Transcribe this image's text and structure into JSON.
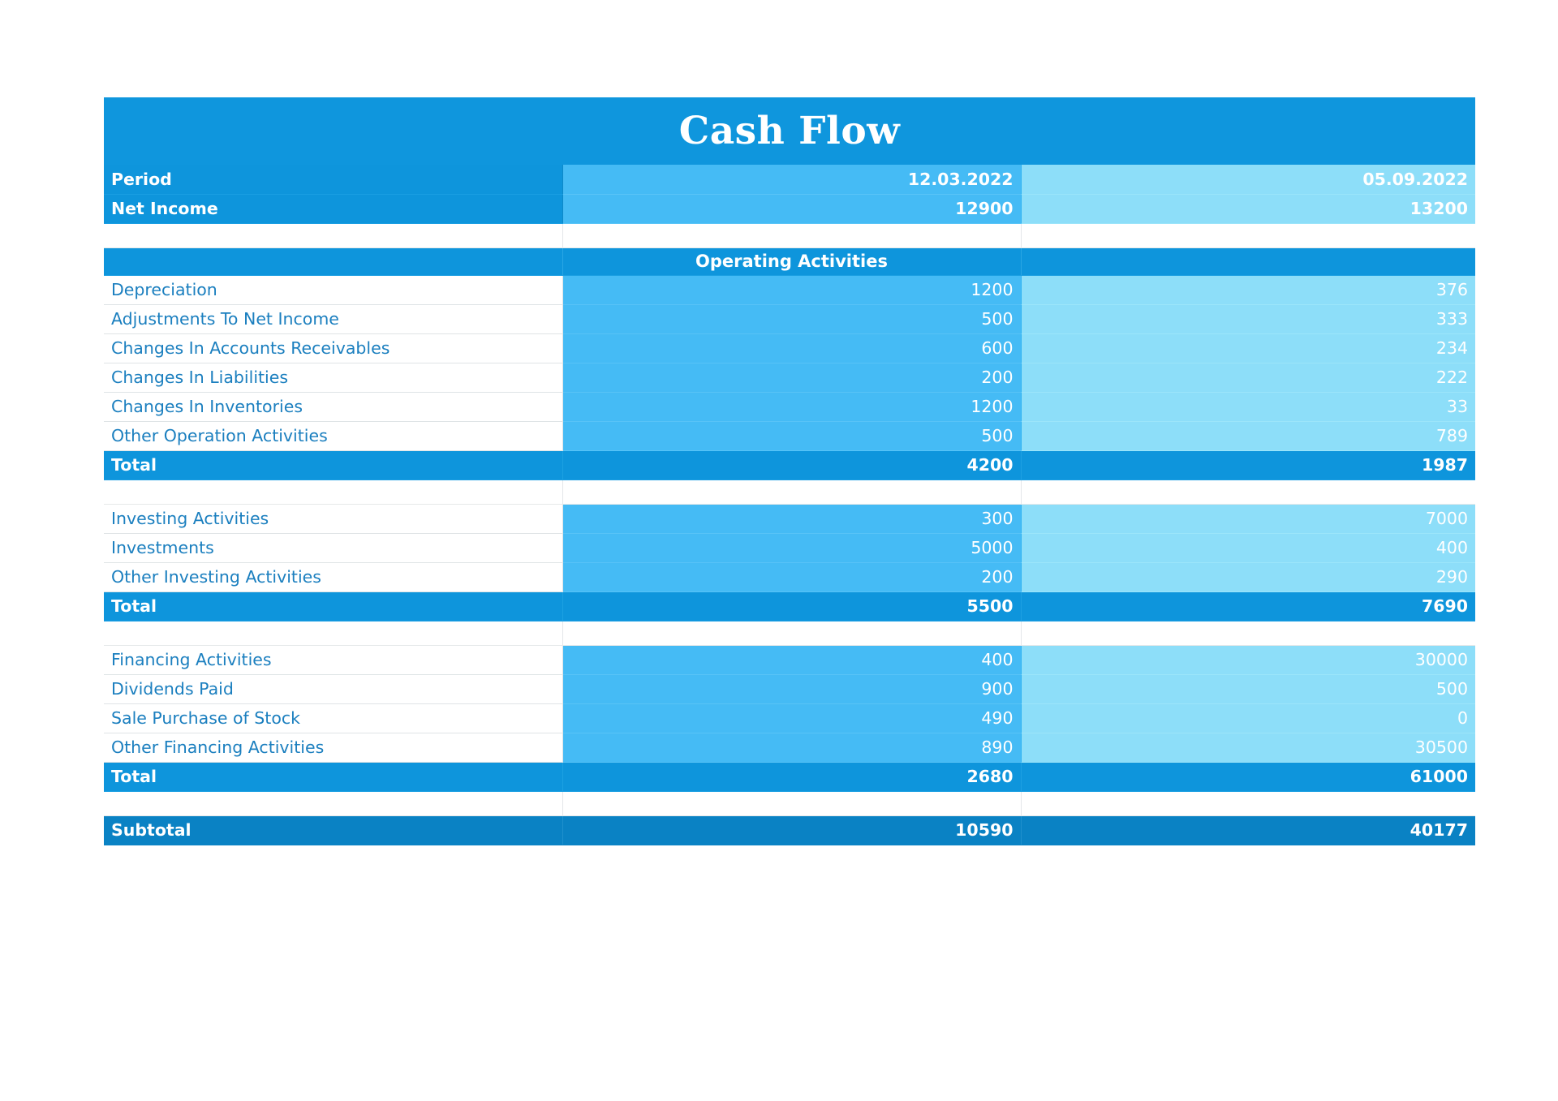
{
  "document": {
    "title": "Cash Flow"
  },
  "colors": {
    "header_blue": "#0e95dc",
    "column_one_blue": "#45bbf5",
    "column_two_cyan": "#8ddef9",
    "subtotal_blue": "#0a82c4",
    "label_text_blue": "#1b7fbf",
    "white": "#ffffff"
  },
  "summary": {
    "period": {
      "label": "Period",
      "value_1": "12.03.2022",
      "value_2": "05.09.2022"
    },
    "net_income": {
      "label": "Net Income",
      "value_1": "12900",
      "value_2": "13200"
    }
  },
  "sections": [
    {
      "banner": "Operating Activities",
      "rows": [
        {
          "label": "Depreciation",
          "value_1": "1200",
          "value_2": "376"
        },
        {
          "label": "Adjustments To Net Income",
          "value_1": "500",
          "value_2": "333"
        },
        {
          "label": "Changes In Accounts Receivables",
          "value_1": "600",
          "value_2": "234"
        },
        {
          "label": "Changes In Liabilities",
          "value_1": "200",
          "value_2": "222"
        },
        {
          "label": "Changes In Inventories",
          "value_1": "1200",
          "value_2": "33"
        },
        {
          "label": "Other Operation Activities",
          "value_1": "500",
          "value_2": "789"
        }
      ],
      "total": {
        "label": "Total",
        "value_1": "4200",
        "value_2": "1987"
      }
    },
    {
      "banner": "",
      "rows": [
        {
          "label": "Investing Activities",
          "value_1": "300",
          "value_2": "7000"
        },
        {
          "label": "Investments",
          "value_1": "5000",
          "value_2": "400"
        },
        {
          "label": "Other Investing Activities",
          "value_1": "200",
          "value_2": "290"
        }
      ],
      "total": {
        "label": "Total",
        "value_1": "5500",
        "value_2": "7690"
      }
    },
    {
      "banner": "",
      "rows": [
        {
          "label": "Financing Activities",
          "value_1": "400",
          "value_2": "30000"
        },
        {
          "label": "Dividends Paid",
          "value_1": "900",
          "value_2": "500"
        },
        {
          "label": "Sale Purchase of Stock",
          "value_1": "490",
          "value_2": "0"
        },
        {
          "label": "Other Financing Activities",
          "value_1": "890",
          "value_2": "30500"
        }
      ],
      "total": {
        "label": "Total",
        "value_1": "2680",
        "value_2": "61000"
      }
    }
  ],
  "subtotal": {
    "label": "Subtotal",
    "value_1": "10590",
    "value_2": "40177"
  }
}
